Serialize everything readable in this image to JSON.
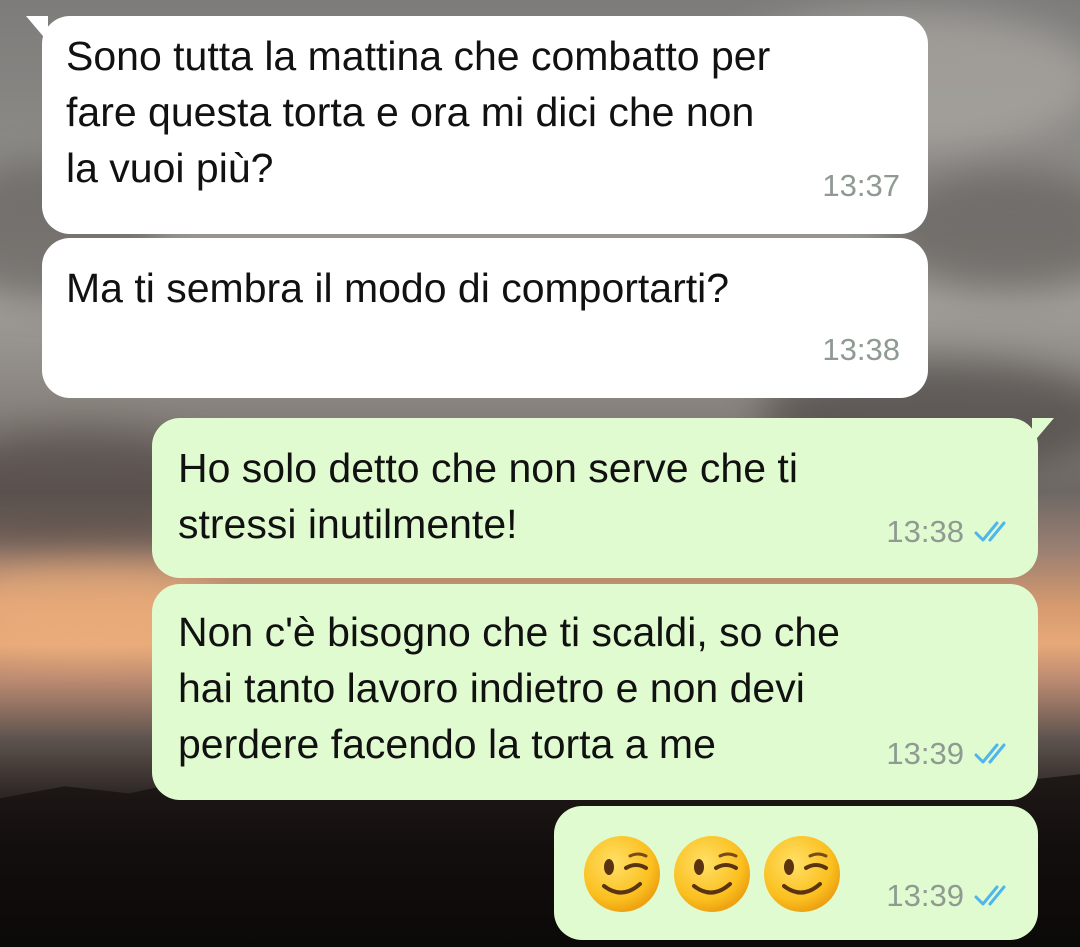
{
  "messages": [
    {
      "text": "Sono tutta la mattina che combatto per\nfare questa torta e ora mi dici che non\nla vuoi più?",
      "time": "13:37"
    },
    {
      "text": "Ma ti sembra il modo di comportarti?",
      "time": "13:38"
    },
    {
      "text": "Ho solo detto che non serve che ti\nstressi inutilmente!",
      "time": "13:38",
      "status": "read"
    },
    {
      "text": "Non c'è bisogno che ti scaldi, so che\nhai tanto lavoro indietro e non devi\nperdere facendo la torta a me",
      "time": "13:39",
      "status": "read"
    },
    {
      "emoji": [
        "winking-face-emoji",
        "winking-face-emoji",
        "winking-face-emoji"
      ],
      "time": "13:39",
      "status": "read"
    }
  ],
  "colors": {
    "incoming_bubble": "#ffffff",
    "outgoing_bubble": "#e1fbd0",
    "timestamp": "#8e9a92",
    "read_ticks": "#4fb6ec"
  }
}
